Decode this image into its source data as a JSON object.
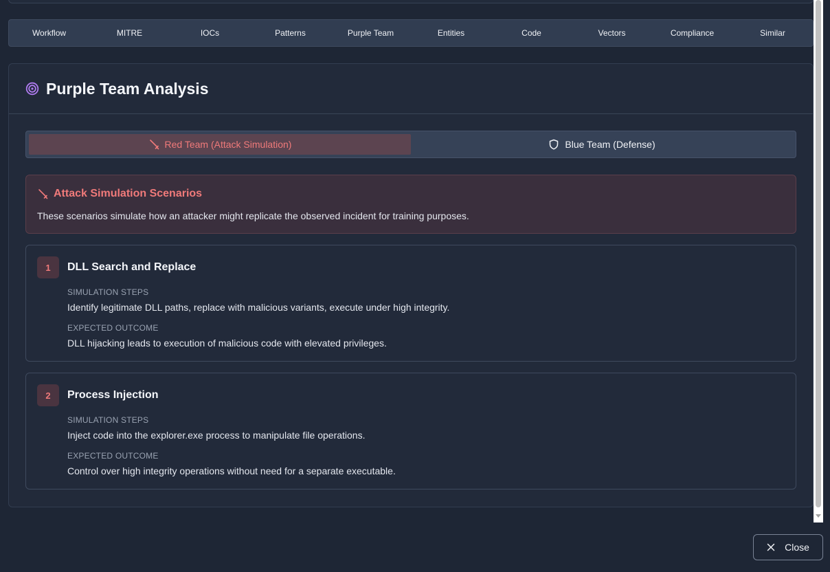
{
  "tabs": [
    "Workflow",
    "MITRE",
    "IOCs",
    "Patterns",
    "Purple Team",
    "Entities",
    "Code",
    "Vectors",
    "Compliance",
    "Similar"
  ],
  "panel": {
    "title": "Purple Team Analysis",
    "icon": "target-icon"
  },
  "toggle": {
    "red_label": "Red Team (Attack Simulation)",
    "blue_label": "Blue Team (Defense)",
    "active": "red"
  },
  "info": {
    "title": "Attack Simulation Scenarios",
    "description": "These scenarios simulate how an attacker might replicate the observed incident for training purposes."
  },
  "scenarios": [
    {
      "number": "1",
      "title": "DLL Search and Replace",
      "steps_label": "SIMULATION STEPS",
      "steps": "Identify legitimate DLL paths, replace with malicious variants, execute under high integrity.",
      "outcome_label": "EXPECTED OUTCOME",
      "outcome": "DLL hijacking leads to execution of malicious code with elevated privileges."
    },
    {
      "number": "2",
      "title": "Process Injection",
      "steps_label": "SIMULATION STEPS",
      "steps": "Inject code into the explorer.exe process to manipulate file operations.",
      "outcome_label": "EXPECTED OUTCOME",
      "outcome": "Control over high integrity operations without need for a separate executable."
    }
  ],
  "close_label": "Close",
  "colors": {
    "red_accent": "#f07a7a",
    "purple_accent": "#b07cf0",
    "background": "#1e2635"
  }
}
